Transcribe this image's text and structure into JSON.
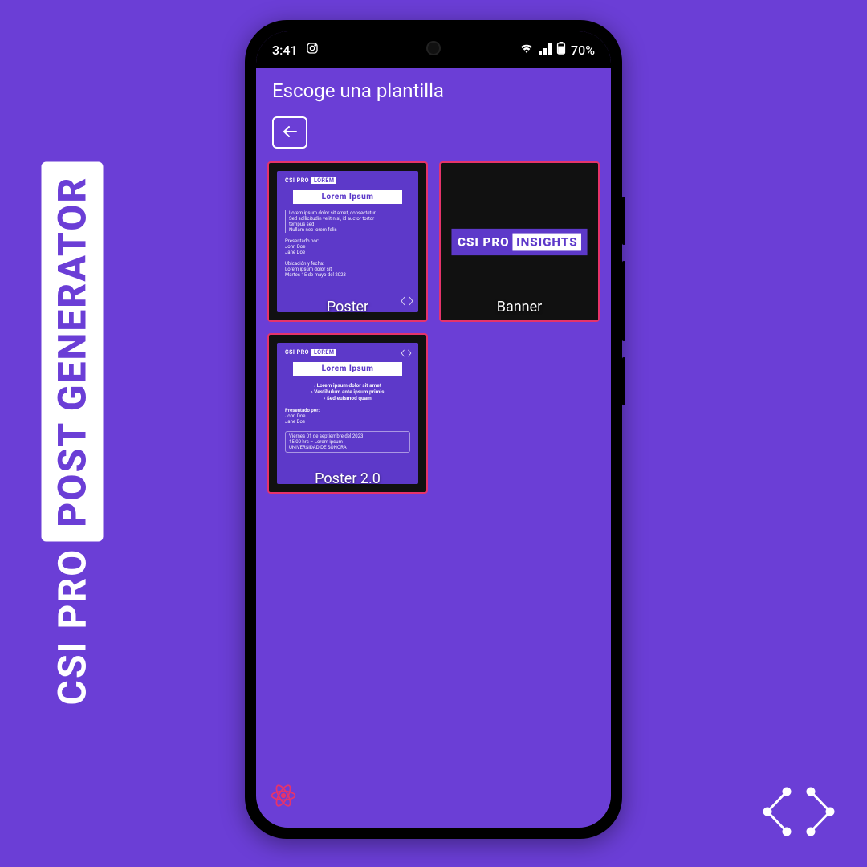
{
  "brand": {
    "pre": "CSI PRO",
    "box": "POST GENERATOR"
  },
  "status": {
    "time": "3:41",
    "battery_text": "70%"
  },
  "app": {
    "title": "Escoge una plantilla"
  },
  "templates": [
    {
      "id": "poster",
      "label": "Poster",
      "preview": {
        "head_pre": "CSI PRO",
        "head_box": "LOREM",
        "title": "Lorem Ipsum",
        "lines": [
          "Lorem ipsum dolor sit amet, consectetur",
          "Sed sollicitudin velit nisi, id auctor tortor",
          "tempus sed",
          "Nullam nec lorem felis"
        ],
        "presented_label": "Presentado por:",
        "presenters": [
          "John Doe",
          "Jane Doe"
        ],
        "location_label": "Ubicación y fecha:",
        "location_lines": [
          "Lorem ipsum dolor sit",
          "Martes 15 de mayo del 2023"
        ]
      }
    },
    {
      "id": "banner",
      "label": "Banner",
      "preview": {
        "pre": "CSI PRO",
        "box": "INSIGHTS"
      }
    },
    {
      "id": "poster2",
      "label": "Poster 2.0",
      "preview": {
        "head_pre": "CSI PRO",
        "head_box": "LOREM",
        "title": "Lorem Ipsum",
        "bullets": [
          "Lorem ipsum dolor sit amet",
          "Vestibulum ante ipsum primis",
          "Sed euismod quam"
        ],
        "presented_label": "Presentado por:",
        "presenters": [
          "John Doe",
          "Jane Doe"
        ],
        "footer_lines": [
          "Viernes 01 de septiembre del 2023",
          "15:00 hrs – Lorem ipsum",
          "UNIVERSIDAD DE SONORA"
        ]
      }
    }
  ]
}
